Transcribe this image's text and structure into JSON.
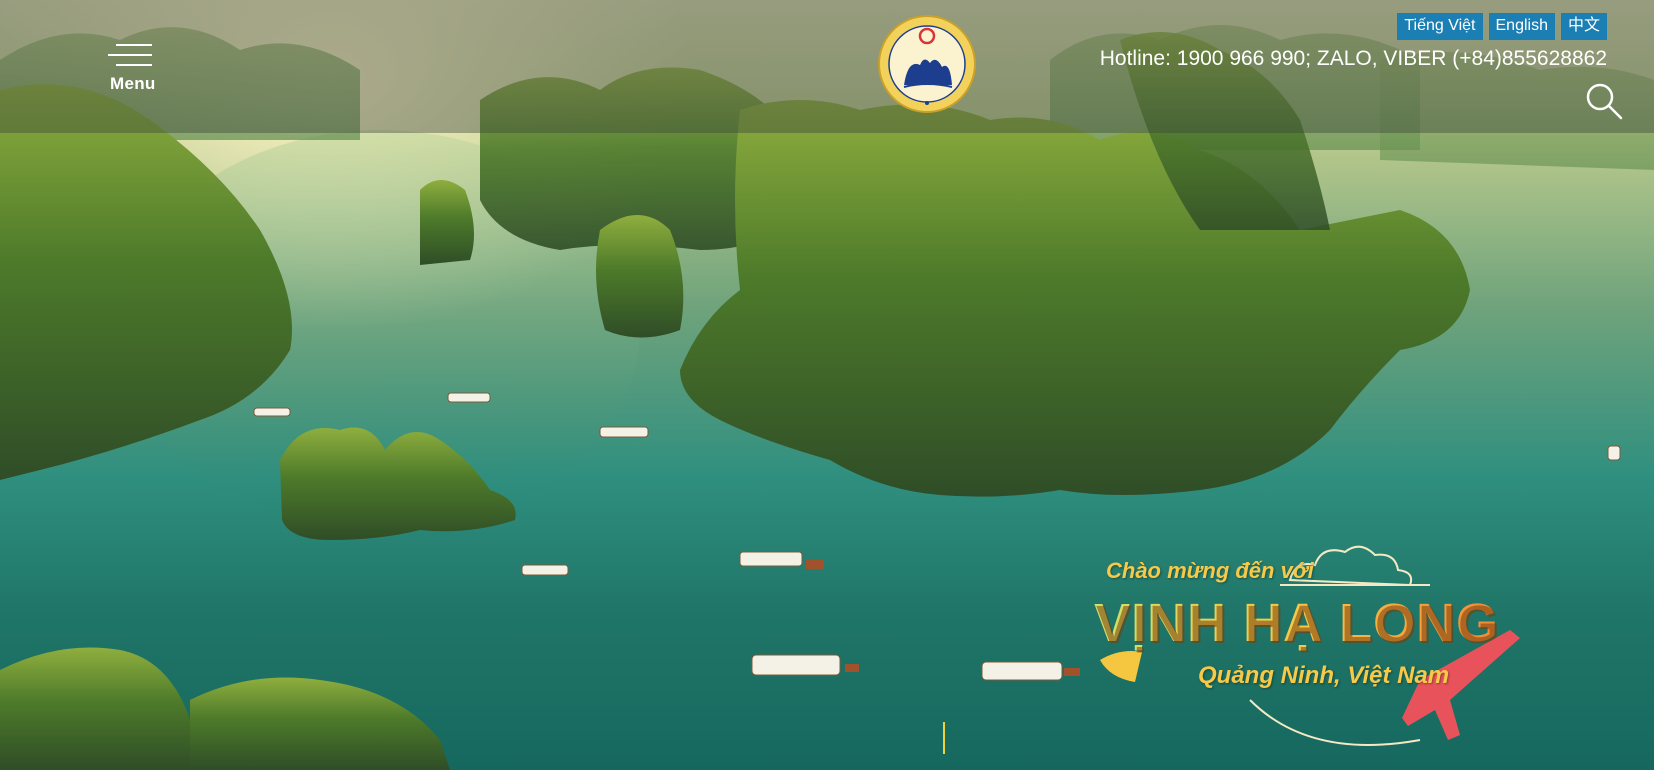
{
  "header": {
    "menu_label": "Menu",
    "logo_alt": "DU LỊCH HẠ LONG • HA LONG TOURISM",
    "languages": [
      "Tiếng Việt",
      "English",
      "中文"
    ],
    "hotline": "Hotline: 1900 966 990; ZALO, VIBER (+84)855628862",
    "search_icon": "search-icon"
  },
  "hero": {
    "welcome_line1": "Chào mừng đến với",
    "welcome_line2": "VỊNH HẠ LONG",
    "welcome_line3": "Quảng Ninh, Việt Nam"
  },
  "colors": {
    "lang_button": "#1b7fb3",
    "title_gold": "#f6c64a",
    "header_overlay": "rgba(60,70,60,0.42)"
  }
}
